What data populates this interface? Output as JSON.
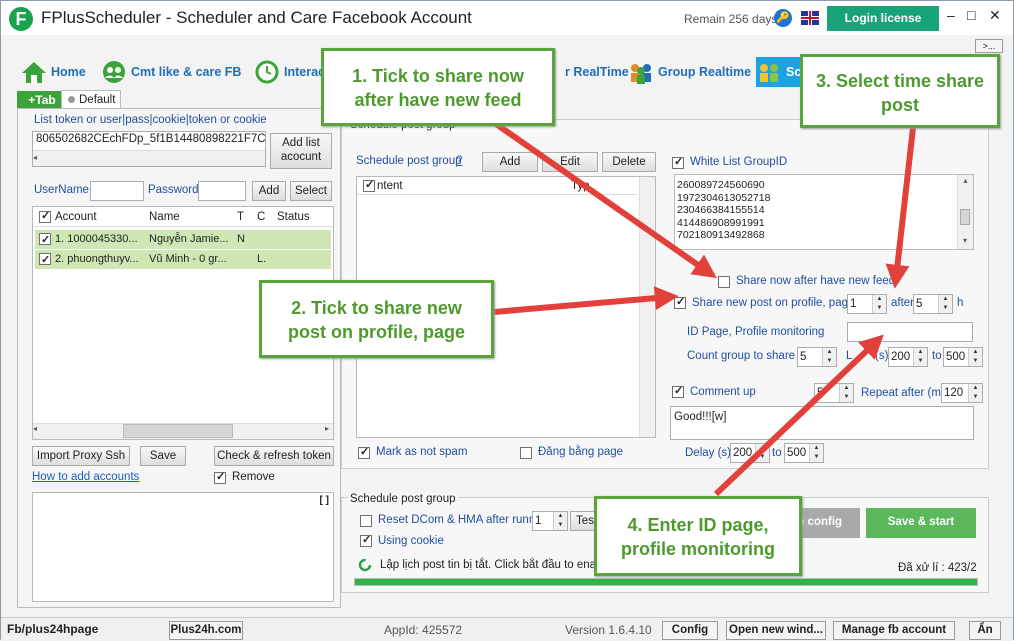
{
  "window": {
    "title": "FPlusScheduler - Scheduler and Care Facebook Account",
    "logo_letter": "F",
    "remain": "Remain 256 days",
    "login_label": "Login license",
    "more_label": ">...",
    "min_label": "–",
    "max_label": "□",
    "close_label": "✕"
  },
  "nav": {
    "home": "Home",
    "cmt": "Cmt like & care FB",
    "interact": "Interac",
    "realtime": "r RealTime",
    "group_realtime": "Group Realtime",
    "sch": "Sch"
  },
  "left": {
    "tab_add": "+Tab",
    "tab_default": "Default",
    "token_label": "List token or user|pass|cookie|token or cookie",
    "token_value": "806502682CEchFDp_5f1B14480898221F7CC;",
    "add_list_btn": [
      "Add list",
      "acocunt"
    ],
    "username_label": "UserName",
    "password_label": "Password",
    "add_btn": "Add",
    "select_btn": "Select",
    "columns": [
      "Account",
      "Name",
      "T",
      "C",
      "Status"
    ],
    "rows": [
      {
        "account": "1. 1000045330...",
        "name": "Nguyễn Jamie...",
        "t": "N",
        "c": ""
      },
      {
        "account": "2. phuongthuyv...",
        "name": "Vũ Minh - 0 gr...",
        "t": "",
        "c": "L."
      }
    ],
    "import_proxy_btn": "Import Proxy Ssh",
    "save_btn": "Save",
    "check_refresh_btn": "Check & refresh token",
    "how_to_link": "How to add accounts",
    "remove_label": "Remove",
    "log_brackets": "[ ]"
  },
  "schedule": {
    "group_title": "Schedule post group",
    "sub_label": "Schedule post group",
    "sub_q": "?",
    "add_btn": "Add",
    "edit_btn": "Edit",
    "delete_btn": "Delete",
    "col_content": "ntent",
    "col_type": "Typ",
    "mark_spam": "Mark as not spam",
    "dang_bang_page": "Đăng bằng page",
    "whitelist_label": "White List GroupID",
    "whitelist_ids": [
      "260089724560690",
      "1972304613052718",
      "230466384155514",
      "414486908991991",
      "702180913492868"
    ],
    "share_now": "Share now after have new feed",
    "share_new_post": "Share new post on profile, page",
    "share_value": "1",
    "after_label": "after",
    "after_value": "5",
    "h_label": "h",
    "id_page_label": "ID Page, Profile monitoring",
    "count_group_label": "Count group to share",
    "count_value": "5",
    "delay_label_frag": "L",
    "delay_s": "(s)",
    "delay_from": "200",
    "to_label": "to",
    "delay_to": "500",
    "comment_up": "Comment up",
    "comment_up_value": "5",
    "repeat_label": "Repeat after (m)",
    "repeat_value": "120",
    "comment_text": "Good!!![w]",
    "delay2_label": "Delay (s)",
    "delay2_from": "200",
    "delay2_to_label": "to",
    "delay2_to": "500"
  },
  "bottom": {
    "group_title": "Schedule post group",
    "reset_dcom": "Reset DCom & HMA after runned",
    "reset_value": "1",
    "test_btn": "Tes",
    "using_cookie": "Using cookie",
    "status_msg": "Lập lịch post tin bị tắt. Click bắt đầu to enable",
    "save_config_btn": "e config",
    "save_start_btn": "Save & start",
    "processed": "Đã xử lí : 423/2",
    "progress": 1.0
  },
  "statusbar": {
    "fb": "Fb/plus24hpage",
    "site": "Plus24h.com",
    "appid": "AppId: 425572",
    "version": "Version 1.6.4.10",
    "config_btn": "Config",
    "open_new_btn": "Open new wind...",
    "manage_btn": "Manage fb account",
    "hide_btn": "Ẩn"
  },
  "callouts": {
    "c1": [
      "1. Tick to share now",
      "after have new feed"
    ],
    "c2": [
      "2. Tick to share new",
      "post on profile, page"
    ],
    "c3": [
      "3. Select time share",
      "post"
    ],
    "c4": [
      "4. Enter ID page,",
      "profile monitoring"
    ]
  },
  "colors": {
    "accent_green": "#5aa43c",
    "arrow_red": "#e2403b",
    "login_teal": "#18a37a",
    "tab_blue": "#1da2e0"
  }
}
